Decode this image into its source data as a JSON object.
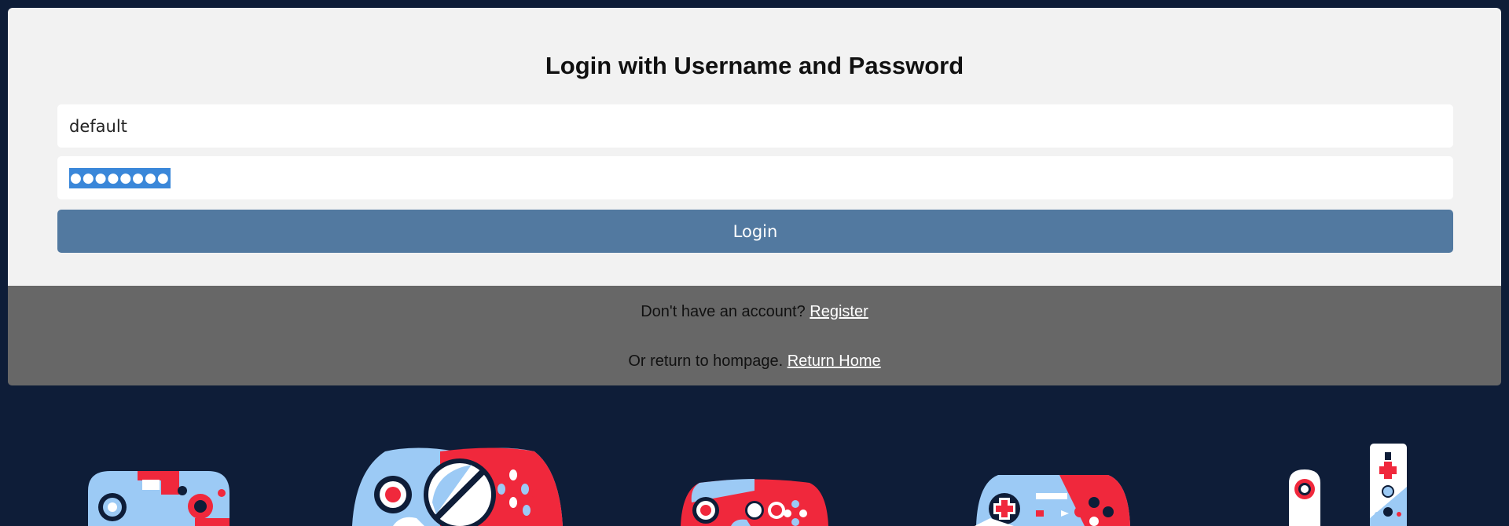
{
  "login": {
    "heading": "Login with Username and Password",
    "username_value": "default",
    "password_masked": "●●●●●●●●",
    "button_label": "Login"
  },
  "footer": {
    "register_prompt": "Don't have an account?",
    "register_link": "Register",
    "home_prompt": "Or return to hompage.",
    "home_link": "Return Home"
  },
  "colors": {
    "background": "#0e1d38",
    "accent_red": "#f0283c",
    "accent_blue": "#9ccaf5",
    "button": "#5279a0"
  },
  "decoration": {
    "icons": [
      "gamecube-controller-icon",
      "xbox-controller-icon",
      "xbox360-controller-icon",
      "ps-controller-icon",
      "wii-remote-icon"
    ]
  }
}
